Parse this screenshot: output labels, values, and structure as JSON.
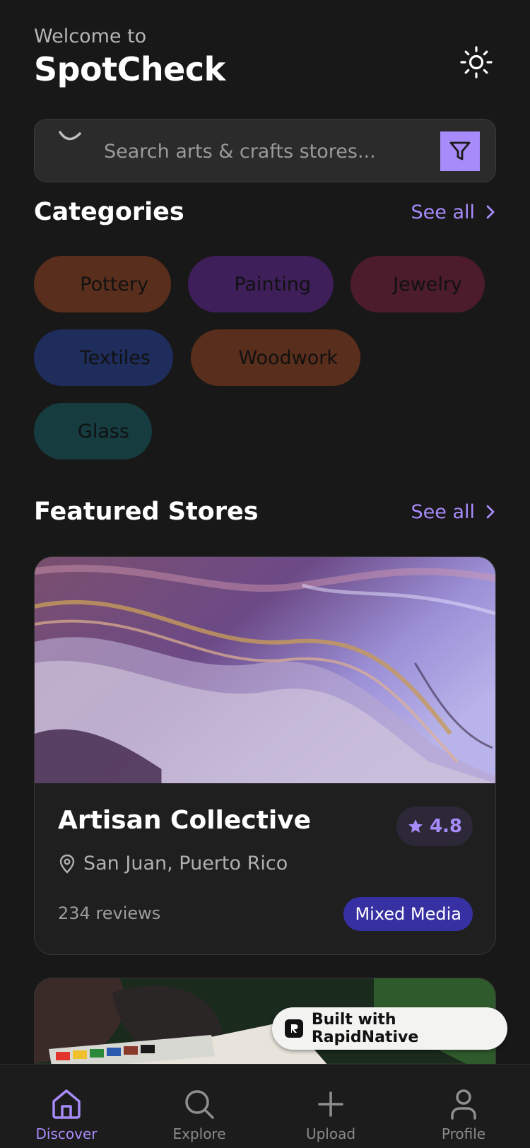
{
  "header": {
    "welcome_text": "Welcome to",
    "app_title": "SpotCheck",
    "theme_toggle_icon": "sun-icon"
  },
  "search": {
    "placeholder": "Search arts & crafts stores...",
    "value": "",
    "icon": "search-icon",
    "filter_icon": "filter-icon"
  },
  "categories": {
    "title": "Categories",
    "see_all_label": "See all",
    "items": [
      {
        "label": "Pottery",
        "color": "#5a2e1c"
      },
      {
        "label": "Painting",
        "color": "#3e1f5a"
      },
      {
        "label": "Jewelry",
        "color": "#4c1c2c"
      },
      {
        "label": "Textiles",
        "color": "#1f2d5c"
      },
      {
        "label": "Woodwork",
        "color": "#5a2e1c"
      },
      {
        "label": "Glass",
        "color": "#163c40"
      }
    ]
  },
  "featured": {
    "title": "Featured Stores",
    "see_all_label": "See all",
    "stores": [
      {
        "name": "Artisan Collective",
        "rating": "4.8",
        "location": "San Juan, Puerto Rico",
        "reviews": "234 reviews",
        "category": "Mixed Media"
      }
    ]
  },
  "built_with": "Built with RapidNative",
  "tabs": [
    {
      "label": "Discover",
      "icon": "home-icon",
      "active": true
    },
    {
      "label": "Explore",
      "icon": "search-icon",
      "active": false
    },
    {
      "label": "Upload",
      "icon": "plus-icon",
      "active": false
    },
    {
      "label": "Profile",
      "icon": "user-icon",
      "active": false
    }
  ],
  "colors": {
    "background": "#181818",
    "accent": "#a78bfa",
    "tag": "#3730a3"
  }
}
